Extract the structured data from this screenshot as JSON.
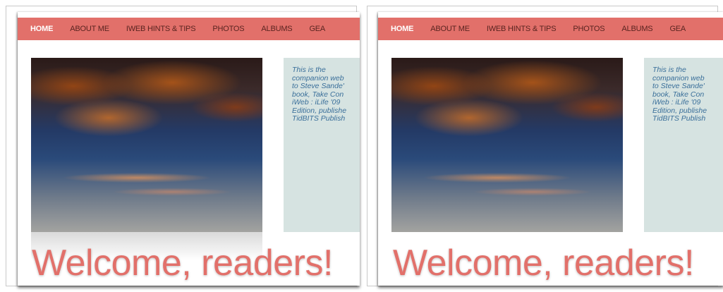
{
  "colors": {
    "nav_background": "#e2706a",
    "nav_text": "#5a2420",
    "nav_active_text": "#ffffff",
    "sidebar_background": "#d6e3e1",
    "sidebar_text": "#3a6f9a",
    "welcome_text": "#e2706a"
  },
  "panels": [
    {
      "nav": {
        "items": [
          {
            "label": "HOME"
          },
          {
            "label": "ABOUT ME"
          },
          {
            "label": "IWEB HINTS & TIPS"
          },
          {
            "label": "PHOTOS"
          },
          {
            "label": "ALBUMS"
          },
          {
            "label": "GEA"
          }
        ]
      },
      "sidebar": {
        "lines": [
          "This is the",
          "companion web",
          "to Steve Sande'",
          "book, Take Con",
          "iWeb : iLife '09",
          "Edition, publishe",
          "TidBITS Publish"
        ]
      },
      "welcome": "Welcome, readers!"
    },
    {
      "nav": {
        "items": [
          {
            "label": "HOME"
          },
          {
            "label": "ABOUT ME"
          },
          {
            "label": "IWEB HINTS & TIPS"
          },
          {
            "label": "PHOTOS"
          },
          {
            "label": "ALBUMS"
          },
          {
            "label": "GEA"
          }
        ]
      },
      "sidebar": {
        "lines": [
          "This is the",
          "companion web",
          "to Steve Sande'",
          "book, Take Con",
          "iWeb : iLife '09",
          "Edition, publishe",
          "TidBITS Publish"
        ]
      },
      "welcome": "Welcome, readers!"
    }
  ]
}
